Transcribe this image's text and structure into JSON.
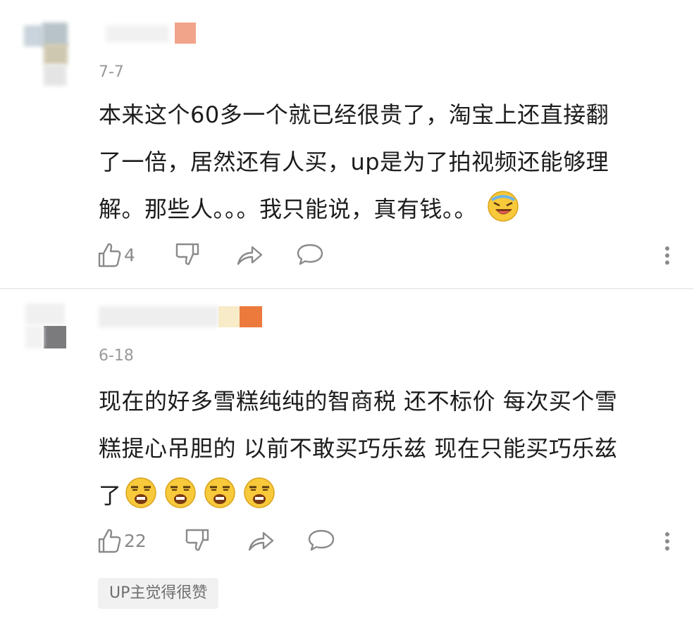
{
  "comments": [
    {
      "date": "7-7",
      "text_lines": [
        "本来这个60多一个就已经很贵了，淘宝上还直接翻",
        "了一倍，居然还有人买，up是为了拍视频还能够理",
        "解。那些人。。。我只能说，真有钱。。"
      ],
      "emojis": [
        "laughing-crying-emoji"
      ],
      "likes": "4",
      "icons": [
        "thumbs-up-icon",
        "thumbs-down-icon",
        "share-icon",
        "reply-icon",
        "more-icon"
      ]
    },
    {
      "date": "6-18",
      "text_lines": [
        "现在的好多雪糕纯纯的智商税 还不标价 每次买个雪",
        "糕提心吊胆的 以前不敢买巧乐兹 现在只能买巧乐兹",
        "了"
      ],
      "emojis": [
        "smirk-emoji",
        "smirk-emoji",
        "smirk-emoji",
        "smirk-emoji"
      ],
      "likes": "22",
      "badge": "UP主觉得很赞",
      "icons": [
        "thumbs-up-icon",
        "thumbs-down-icon",
        "share-icon",
        "reply-icon",
        "more-icon"
      ]
    }
  ],
  "colors": {
    "text": "#1c1c1c",
    "meta": "#9a9a9a",
    "icon": "#8a8a8a",
    "divider": "#ececec",
    "emoji_yellow": "#f8c93a"
  }
}
